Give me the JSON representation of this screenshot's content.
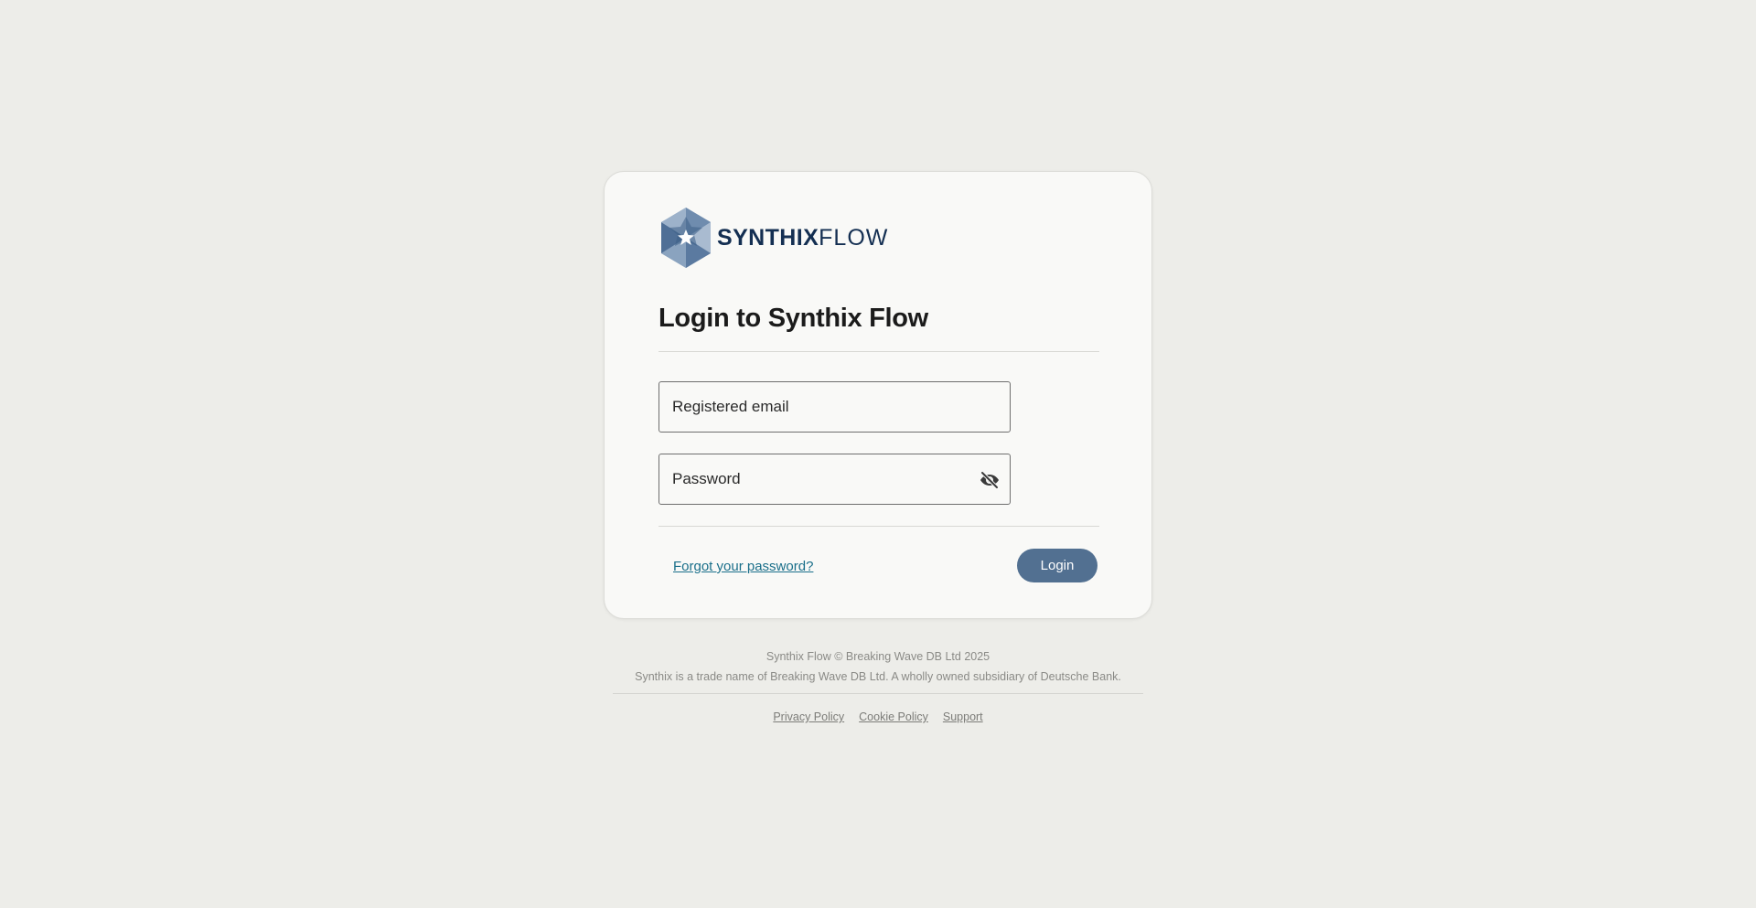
{
  "brand": {
    "name_bold": "SYNTHIX",
    "name_light": "FLOW",
    "logo_icon": "hexagon-star-logo-icon",
    "color": "#142f52"
  },
  "login": {
    "title": "Login to Synthix Flow",
    "email_placeholder": "Registered email",
    "password_placeholder": "Password",
    "toggle_visibility_icon": "eye-slash-icon",
    "forgot_password_label": "Forgot your password?",
    "login_button_label": "Login",
    "accent_color": "#527091",
    "link_color": "#1a6f8a"
  },
  "footer": {
    "copyright": "Synthix Flow © Breaking Wave DB Ltd 2025",
    "legal_note": "Synthix is a trade name of Breaking Wave DB Ltd. A wholly owned subsidiary of Deutsche Bank.",
    "links": [
      {
        "label": "Privacy Policy"
      },
      {
        "label": "Cookie Policy"
      },
      {
        "label": "Support"
      }
    ]
  }
}
